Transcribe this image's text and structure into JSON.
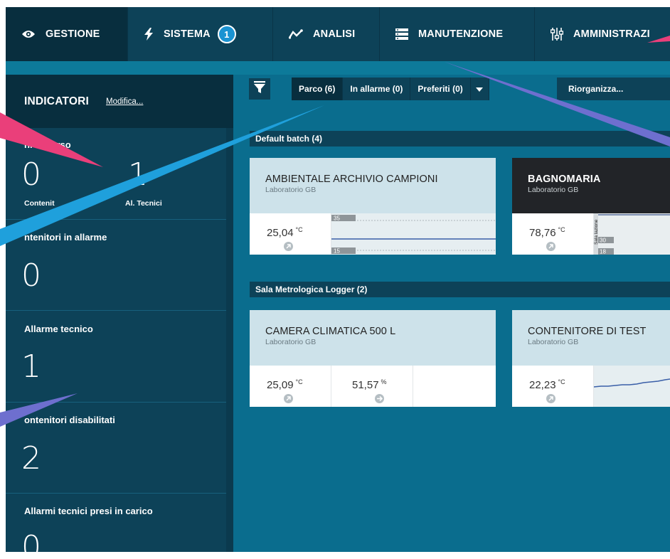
{
  "topnav": {
    "tabs": [
      {
        "label": "GESTIONE",
        "icon": "eye-icon"
      },
      {
        "label": "SISTEMA",
        "icon": "lightning-icon",
        "badge": "1"
      },
      {
        "label": "ANALISI",
        "icon": "trend-line-icon"
      },
      {
        "label": "MANUTENZIONE",
        "icon": "server-icon"
      },
      {
        "label": "AMMINISTRAZI",
        "icon": "sliders-icon"
      }
    ]
  },
  "sidebar": {
    "title": "INDICATORI",
    "edit_label": "Modifica...",
    "indicators": [
      {
        "label": "ni in corso",
        "value": "0",
        "sub1": "Contenit",
        "value2": "1",
        "sub2": "Al. Tecnici"
      },
      {
        "label": "ntenitori in allarme",
        "value": "0"
      },
      {
        "label": "Allarme tecnico",
        "value": "1"
      },
      {
        "label": "ontenitori disabilitati",
        "value": "2"
      },
      {
        "label": "Allarmi tecnici presi in carico",
        "value": "0"
      }
    ]
  },
  "toolbar": {
    "view_tabs": [
      "Parco (6)",
      "In allarme (0)",
      "Preferiti (0)"
    ],
    "reorganize_label": "Riorganizza..."
  },
  "groups": [
    {
      "title": "Default batch (4)",
      "cards": [
        {
          "title": "AMBIENTALE ARCHIVIO CAMPIONI",
          "subtitle": "Laboratorio GB",
          "value": "25,04",
          "unit": "°C",
          "trend": {
            "upper": "35",
            "lower": "15"
          }
        },
        {
          "title": "BAGNOMARIA",
          "subtitle": "Laboratorio GB",
          "value": "78,76",
          "unit": "°C",
          "trend": {
            "upper": "30",
            "lower": "18",
            "side": "Sala lazione"
          }
        }
      ]
    },
    {
      "title": "Sala Metrologica Logger (2)",
      "cards": [
        {
          "title": "CAMERA CLIMATICA 500 L",
          "subtitle": "Laboratorio GB",
          "value": "25,09",
          "unit": "°C",
          "value2": "51,57",
          "unit2": "%"
        },
        {
          "title": "CONTENITORE DI TEST",
          "subtitle": "Laboratorio GB",
          "value": "22,23",
          "unit": "°C"
        }
      ]
    }
  ],
  "colors": {
    "app_background": "#0a6d8e",
    "nav_background": "#0d4258",
    "nav_active": "#082e3e",
    "badge": "#1a93d2",
    "card_header": "#cde2ea",
    "card_header_dark": "#222428",
    "trend_line": "#3a5fa8",
    "arrow_pink": "#ea3f7a",
    "arrow_blue": "#1fa0dc",
    "arrow_purple": "#6e6fcf"
  }
}
